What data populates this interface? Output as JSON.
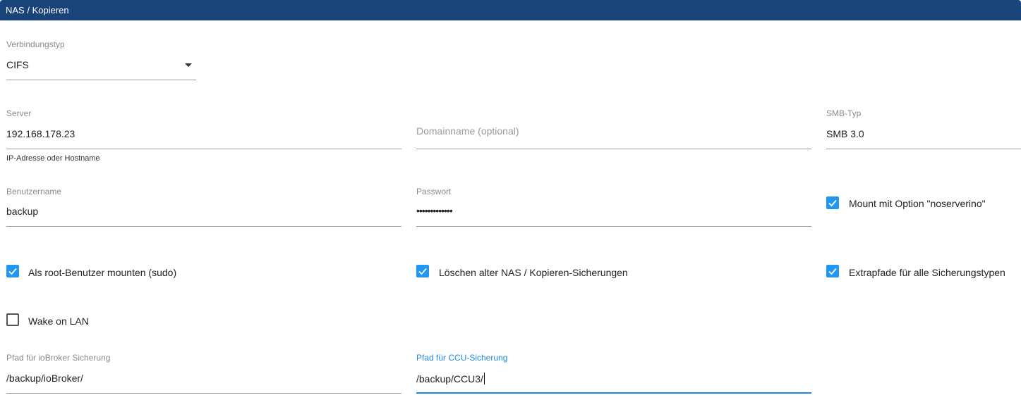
{
  "header": {
    "title": "NAS / Kopieren"
  },
  "colors": {
    "header_bg": "#19447a",
    "checkbox": "#2196f3",
    "focus": "#1e88e5"
  },
  "connection_type": {
    "label": "Verbindungstyp",
    "value": "CIFS"
  },
  "server": {
    "label": "Server",
    "value": "192.168.178.23",
    "helper": "IP-Adresse oder Hostname"
  },
  "domain": {
    "placeholder": "Domainname (optional)"
  },
  "smb_type": {
    "label": "SMB-Typ",
    "value": "SMB 3.0"
  },
  "username": {
    "label": "Benutzername",
    "value": "backup"
  },
  "password": {
    "label": "Passwort",
    "value": "•••••••••••••"
  },
  "checkboxes": {
    "noserverino": {
      "label": "Mount mit Option \"noserverino\"",
      "checked": true
    },
    "sudo": {
      "label": "Als root-Benutzer mounten (sudo)",
      "checked": true
    },
    "delete_old": {
      "label": "Löschen alter NAS / Kopieren-Sicherungen",
      "checked": true
    },
    "extra_paths": {
      "label": "Extrapfade für alle Sicherungstypen",
      "checked": true
    },
    "wake_on_lan": {
      "label": "Wake on LAN",
      "checked": false
    }
  },
  "iobroker_path": {
    "label": "Pfad für ioBroker Sicherung",
    "value": "/backup/ioBroker/"
  },
  "ccu_path": {
    "label": "Pfad für CCU-Sicherung",
    "value": "/backup/CCU3/"
  }
}
